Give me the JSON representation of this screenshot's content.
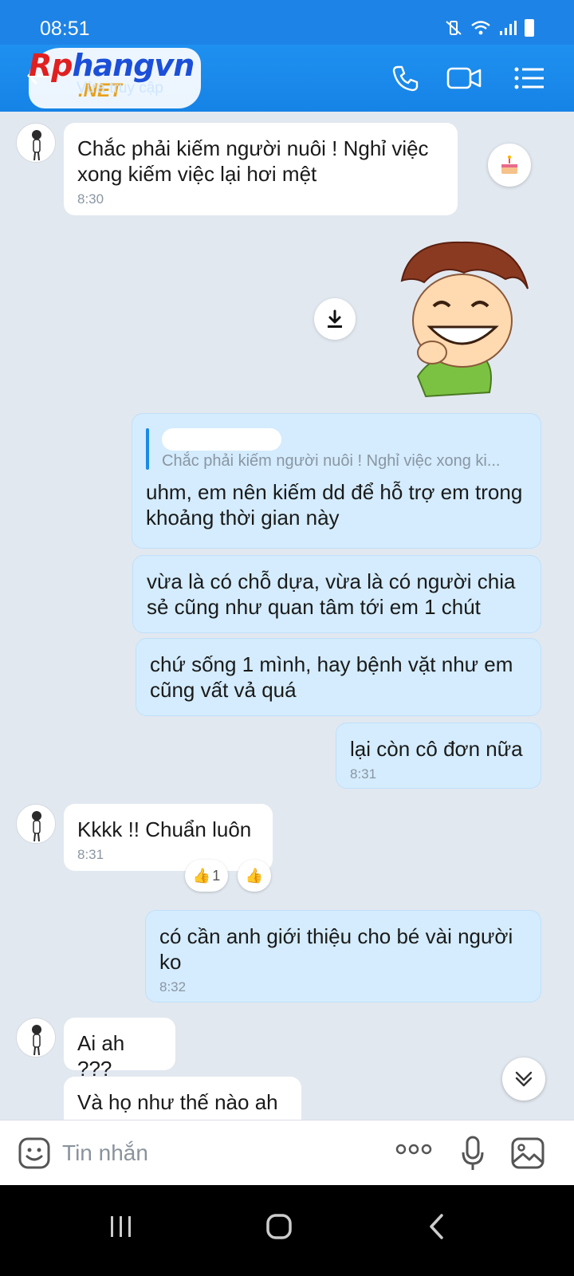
{
  "status_bar": {
    "time": "08:51"
  },
  "header": {
    "logo_text_1": "Rp",
    "logo_text_2": "hangvn",
    "logo_sub": ".NET",
    "status": "Vừa truy cập"
  },
  "messages": [
    {
      "from": "in",
      "text": "Chắc phải kiếm người nuôi ! Nghỉ việc xong kiếm việc lại hơi mệt",
      "time": "8:30"
    },
    {
      "from": "out",
      "quote": "Chắc phải kiếm người nuôi ! Nghỉ việc xong ki...",
      "text": "uhm, em nên kiếm dd để hỗ trợ em trong khoảng thời gian này"
    },
    {
      "from": "out",
      "text": "vừa là có chỗ dựa, vừa là có người chia sẻ cũng như quan tâm tới em 1 chút"
    },
    {
      "from": "out",
      "text": "chứ sống 1 mình, hay bệnh vặt như em cũng vất vả quá"
    },
    {
      "from": "out",
      "text": "lại còn cô đơn nữa",
      "time": "8:31"
    },
    {
      "from": "in",
      "text": "Kkkk !! Chuẩn luôn",
      "time": "8:31",
      "reaction_count": "1"
    },
    {
      "from": "out",
      "text": "có cần anh giới thiệu cho bé vài người ko",
      "time": "8:32"
    },
    {
      "from": "in",
      "text": "Ai ah ???"
    },
    {
      "from": "in",
      "text": "Và họ như thế nào ah"
    }
  ],
  "input": {
    "placeholder": "Tin nhắn"
  },
  "icons": {
    "back": "back-arrow-icon",
    "call": "phone-icon",
    "video": "video-camera-icon",
    "menu": "list-menu-icon",
    "cake": "birthday-cake-icon",
    "download": "download-icon",
    "scroll": "chevron-double-down-icon",
    "sticker": "sticker-smiley-icon",
    "more": "more-dots-icon",
    "mic": "microphone-icon",
    "image": "image-icon"
  },
  "colors": {
    "header": "#1683e6",
    "outgoing_bubble": "#d4ecfd",
    "incoming_bubble": "#ffffff",
    "background": "#e2e8f0"
  }
}
